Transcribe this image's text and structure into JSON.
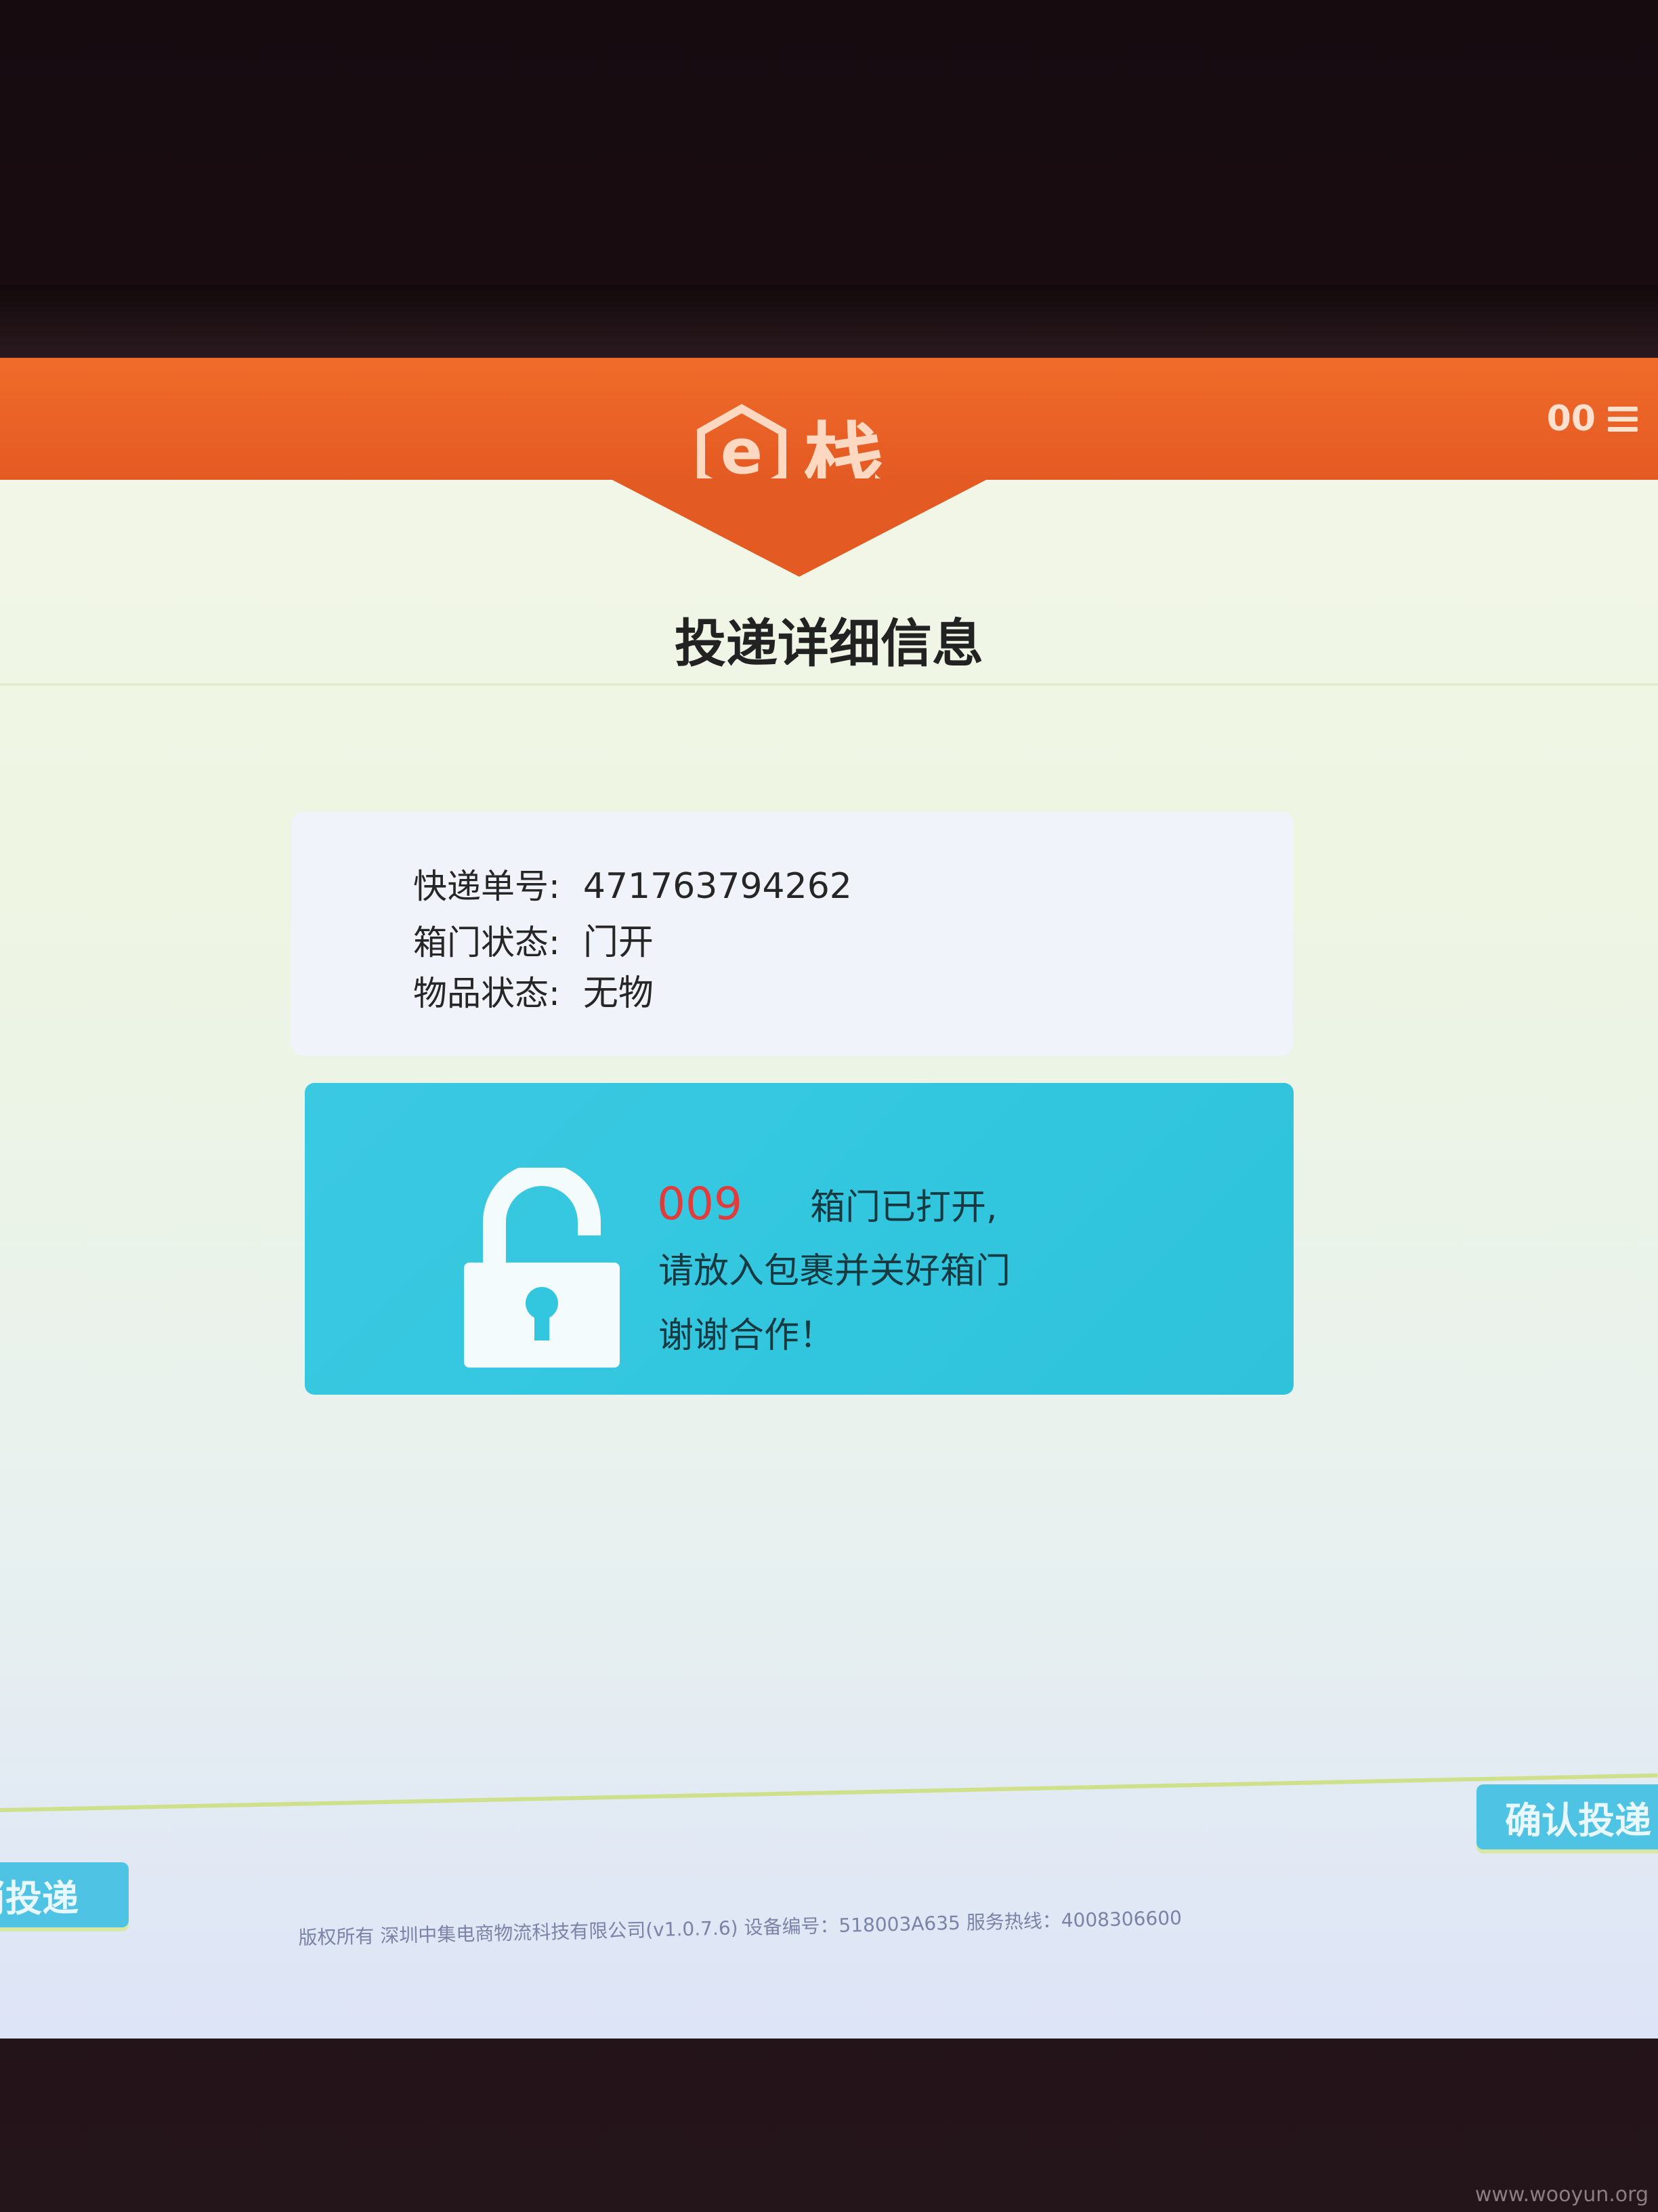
{
  "header": {
    "logo_letter": "e",
    "logo_text": "栈",
    "right_text": "00"
  },
  "page_title": "投递详细信息",
  "info": {
    "tracking_label": "快递单号:",
    "tracking_value": "471763794262",
    "door_label": "箱门状态:",
    "door_value": "门开",
    "item_label": "物品状态:",
    "item_value": "无物"
  },
  "notice": {
    "box_number": "009",
    "line1": "箱门已打开,",
    "line2": "请放入包裹并关好箱门",
    "line3": "谢谢合作！"
  },
  "buttons": {
    "cancel": "消投递",
    "confirm": "确认投递"
  },
  "footer": "版权所有  深圳中集电商物流科技有限公司(v1.0.7.6)  设备编号：518003A635  服务热线：4008306600",
  "watermark": "www.wooyun.org",
  "colors": {
    "header": "#e45a23",
    "notice_bg": "#33c7df",
    "box_number": "#e23b3b",
    "button": "#4fc3e3"
  }
}
